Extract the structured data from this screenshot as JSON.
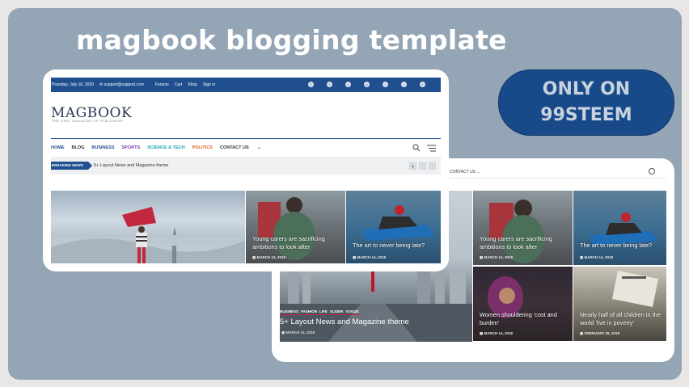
{
  "headline": "magbook blogging template",
  "badge": {
    "line1": "ONLY ON",
    "line2": "99STEEM"
  },
  "site": {
    "topbar": {
      "date": "Thursday, July 16, 2020",
      "email": "support@support.com",
      "links": [
        "Forums",
        "Cart",
        "Shop",
        "Sign in"
      ]
    },
    "logo": "MAGBOOK",
    "tagline": "THE NEXT MAGAZINE OF PUBLISHING",
    "nav": [
      {
        "label": "HOME",
        "color": "#1f4f8f"
      },
      {
        "label": "BLOG",
        "color": "#333333"
      },
      {
        "label": "BUSINESS",
        "color": "#1f4f8f"
      },
      {
        "label": "SPORTS",
        "color": "#7b3fb5"
      },
      {
        "label": "SCIENCE & TECH",
        "color": "#1aa3b8"
      },
      {
        "label": "POLITICS",
        "color": "#e0622b"
      },
      {
        "label": "CONTACT US",
        "color": "#333333"
      }
    ],
    "breaking": {
      "label": "BREAKING NEWS",
      "text": "5+ Layout News and Magazine theme"
    },
    "contact_small": "CONTACT US",
    "tiles": {
      "young": {
        "title": "Young carers are sacrificing ambitions to look after",
        "date": "MARCH 14, 2018"
      },
      "boat": {
        "title": "The art to never being late?",
        "date": "MARCH 14, 2018"
      },
      "women": {
        "title": "Women shouldering 'cost and burden'",
        "date": "MARCH 14, 2018"
      },
      "children": {
        "title": "Nearly half of all children in the world 'live in poverty'",
        "date": "FEBRUARY 26, 2018"
      }
    },
    "hero": {
      "categories": [
        "BUSINESS",
        "FASHION",
        "LIFE",
        "SLIDER",
        "VOGUE"
      ],
      "title": "5+ Layout News and Magazine theme",
      "date": "MARCH 14, 2018"
    }
  }
}
